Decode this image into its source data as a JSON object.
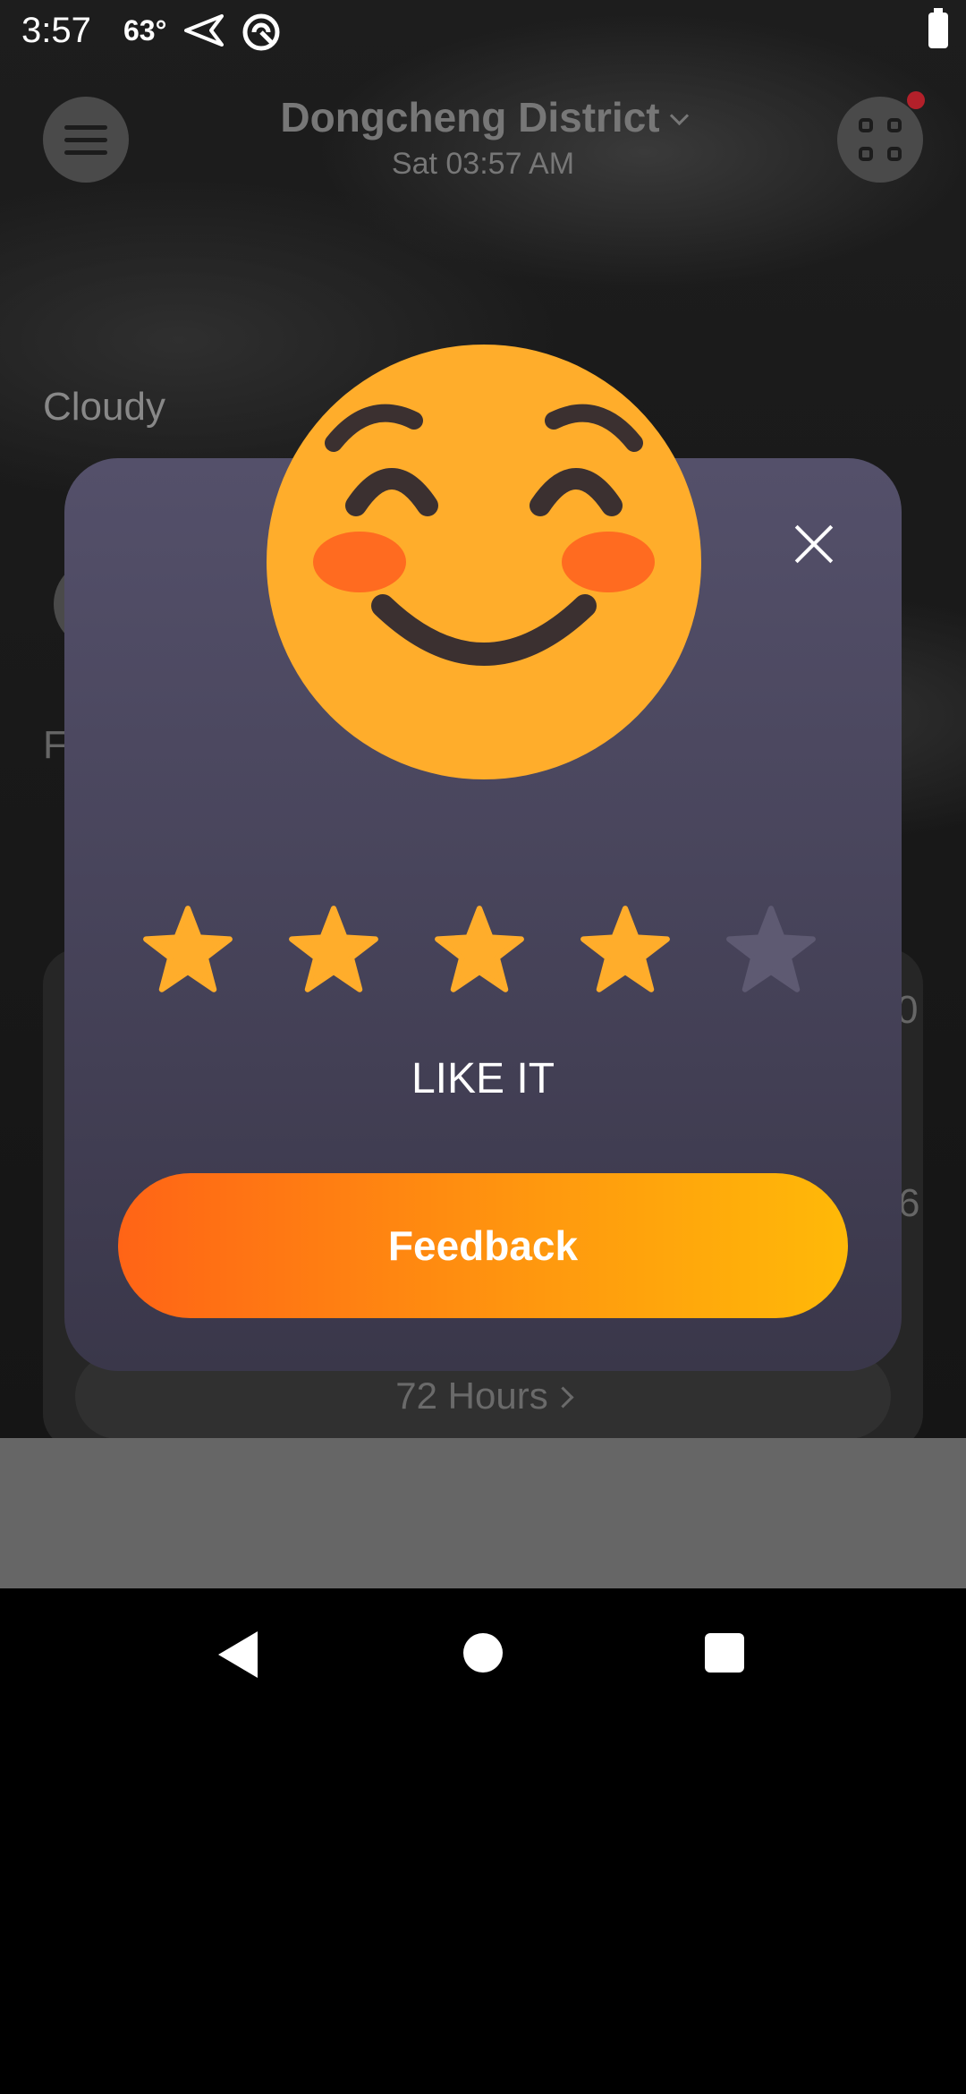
{
  "status_bar": {
    "time": "3:57",
    "temperature": "63°"
  },
  "header": {
    "location": "Dongcheng District",
    "datetime": "Sat 03:57 AM"
  },
  "weather": {
    "condition": "Cloudy",
    "hours_link": "72 Hours"
  },
  "dialog": {
    "rating": 4,
    "max_rating": 5,
    "label": "LIKE IT",
    "button": "Feedback",
    "colors": {
      "star_active": "#ffad2b",
      "star_inactive": "#5e5a72",
      "button_start": "#ff6416",
      "button_end": "#ffb908"
    }
  }
}
